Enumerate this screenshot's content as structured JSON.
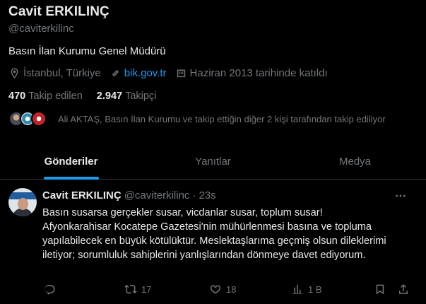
{
  "profile": {
    "display_name": "Cavit ERKILINÇ",
    "handle": "@caviterkilinc",
    "bio": "Basın İlan Kurumu Genel Müdürü",
    "location": "İstanbul, Türkiye",
    "website": "bik.gov.tr",
    "joined": "Haziran 2013 tarihinde katıldı",
    "following_count": "470",
    "following_label": "Takip edilen",
    "followers_count": "2.947",
    "followers_label": "Takipçi",
    "followed_by_text": "Ali AKTAŞ, Basın İlan Kurumu ve takip ettiğin diğer 2 kişi tarafından takip ediliyor"
  },
  "tabs": [
    {
      "label": "Gönderiler",
      "active": true
    },
    {
      "label": "Yanıtlar",
      "active": false
    },
    {
      "label": "Medya",
      "active": false
    }
  ],
  "tweet": {
    "name": "Cavit ERKILINÇ",
    "handle": "@caviterkilinc",
    "separator": "·",
    "time": "23s",
    "text": "Basın susarsa gerçekler susar, vicdanlar susar, toplum susar!\nAfyonkarahisar Kocatepe Gazetesi'nin mühürlenmesi basına ve topluma yapılabilecek en büyük kötülüktür. Meslektaşlarıma geçmiş olsun dileklerimi iletiyor; sorumluluk sahiplerini yanlışlarından dönmeye davet ediyorum.",
    "retweets": "17",
    "likes": "18",
    "views": "1 B"
  },
  "colors": {
    "background": "#000000",
    "text": "#e7e9ea",
    "secondary": "#71767b",
    "accent": "#1d9bf0",
    "border": "#2f3336"
  },
  "icons": [
    "location-icon",
    "link-icon",
    "calendar-icon",
    "more-icon",
    "reply-icon",
    "retweet-icon",
    "like-icon",
    "views-icon",
    "bookmark-icon",
    "share-icon"
  ]
}
